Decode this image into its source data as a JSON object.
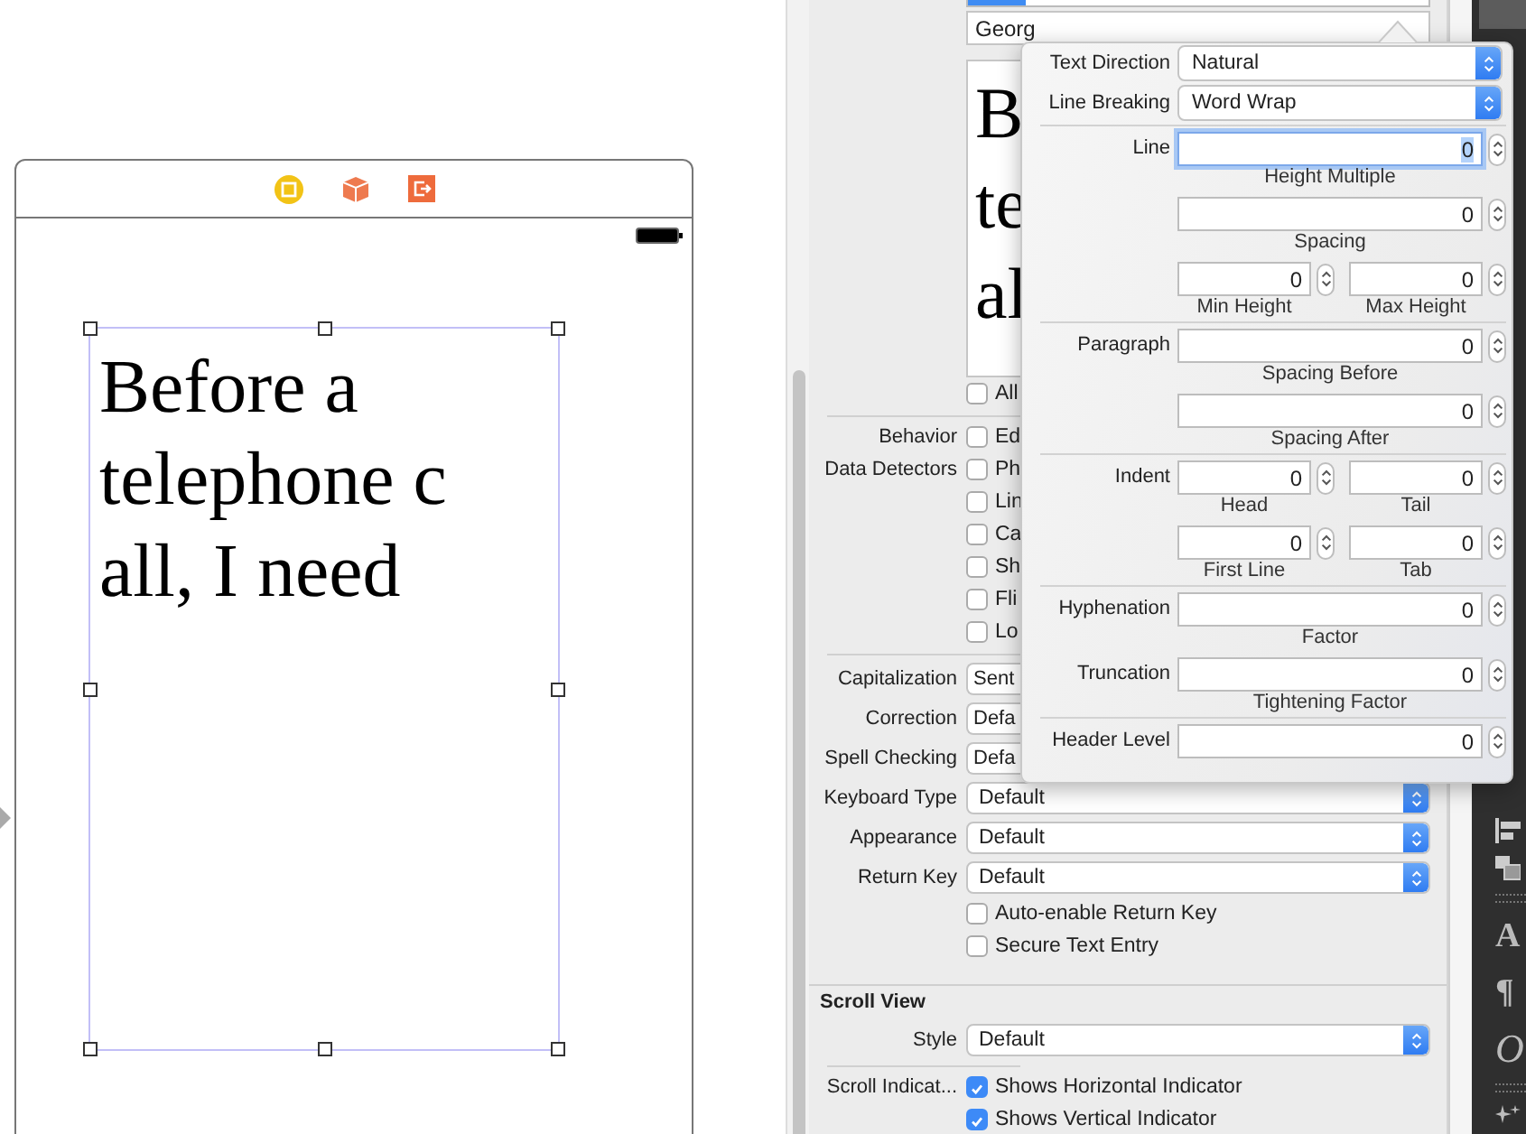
{
  "scene": {
    "text_lines": [
      "Before a",
      "telephone c",
      "all, I need"
    ]
  },
  "inspector": {
    "font_field": "Georg",
    "preview_lines": [
      "B",
      "te",
      "al"
    ],
    "rows": [
      {
        "kind": "checkbox",
        "text": "All",
        "checked": false
      },
      {
        "kind": "separator"
      },
      {
        "kind": "checkbox",
        "label": "Behavior",
        "text": "Ed",
        "checked": false
      },
      {
        "kind": "checkbox",
        "label": "Data Detectors",
        "text": "Ph",
        "checked": false
      },
      {
        "kind": "checkbox",
        "text": "Lin",
        "checked": false
      },
      {
        "kind": "checkbox",
        "text": "Ca",
        "checked": false
      },
      {
        "kind": "checkbox",
        "text": "Sh",
        "checked": false
      },
      {
        "kind": "checkbox",
        "text": "Fli",
        "checked": false
      },
      {
        "kind": "checkbox",
        "text": "Lo",
        "checked": false
      },
      {
        "kind": "separator"
      },
      {
        "kind": "select",
        "label": "Capitalization",
        "value": "Sent",
        "cut": true
      },
      {
        "kind": "select",
        "label": "Correction",
        "value": "Defa",
        "cut": true
      },
      {
        "kind": "select",
        "label": "Spell Checking",
        "value": "Defa",
        "cut": true
      },
      {
        "kind": "select",
        "label": "Keyboard Type",
        "value": "Default",
        "cut": false
      },
      {
        "kind": "select",
        "label": "Appearance",
        "value": "Default",
        "cut": false
      },
      {
        "kind": "select",
        "label": "Return Key",
        "value": "Default",
        "cut": false
      },
      {
        "kind": "checkbox",
        "text": "Auto-enable Return Key",
        "checked": false
      },
      {
        "kind": "checkbox",
        "text": "Secure Text Entry",
        "checked": false
      },
      {
        "kind": "section",
        "title": "Scroll View"
      },
      {
        "kind": "select",
        "label": "Style",
        "value": "Default",
        "cut": false
      },
      {
        "kind": "separator"
      },
      {
        "kind": "checkbox",
        "label": "Scroll Indicat...",
        "text": "Shows Horizontal Indicator",
        "checked": true
      },
      {
        "kind": "checkbox",
        "text": "Shows Vertical Indicator",
        "checked": true
      }
    ]
  },
  "popover": {
    "sections": [
      [
        {
          "kind": "select",
          "label": "Text Direction",
          "value": "Natural"
        },
        {
          "kind": "select",
          "label": "Line Breaking",
          "value": "Word Wrap"
        }
      ],
      [
        {
          "kind": "field",
          "label": "Line",
          "value": "0",
          "caption": "Height Multiple",
          "focused": true
        },
        {
          "kind": "field",
          "value": "0",
          "caption": "Spacing",
          "focused": false
        },
        {
          "kind": "pair",
          "fields": [
            {
              "value": "0",
              "caption": "Min Height"
            },
            {
              "value": "0",
              "caption": "Max Height"
            }
          ]
        }
      ],
      [
        {
          "kind": "field",
          "label": "Paragraph",
          "value": "0",
          "caption": "Spacing Before",
          "focused": false
        },
        {
          "kind": "field",
          "value": "0",
          "caption": "Spacing After",
          "focused": false
        }
      ],
      [
        {
          "kind": "pair",
          "label": "Indent",
          "fields": [
            {
              "value": "0",
              "caption": "Head"
            },
            {
              "value": "0",
              "caption": "Tail"
            }
          ]
        },
        {
          "kind": "pair",
          "fields": [
            {
              "value": "0",
              "caption": "First Line"
            },
            {
              "value": "0",
              "caption": "Tab"
            }
          ]
        }
      ],
      [
        {
          "kind": "field",
          "label": "Hyphenation",
          "value": "0",
          "caption": "Factor",
          "focused": false
        },
        {
          "kind": "field",
          "label": "Truncation",
          "value": "0",
          "caption": "Tightening Factor",
          "focused": false
        }
      ],
      [
        {
          "kind": "field",
          "label": "Header Level",
          "value": "0",
          "focused": false
        }
      ]
    ]
  },
  "toolbar_glyphs": [
    "A",
    "¶",
    "O"
  ]
}
